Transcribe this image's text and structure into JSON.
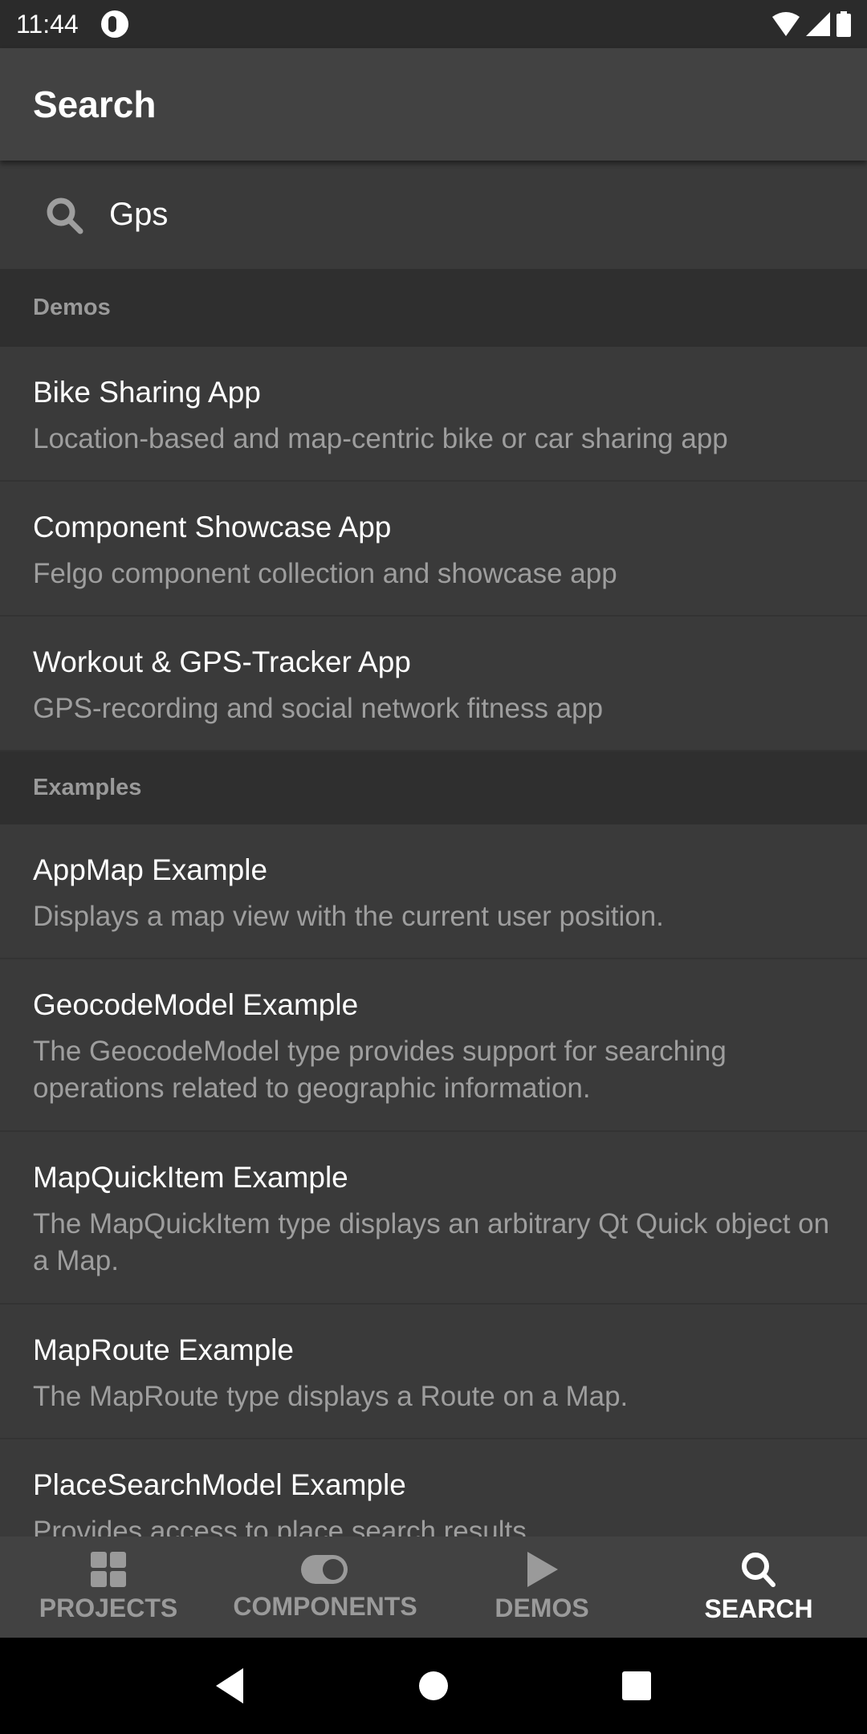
{
  "status_bar": {
    "time": "11:44"
  },
  "app_bar": {
    "title": "Search"
  },
  "search": {
    "value": "Gps"
  },
  "sections": [
    {
      "header": "Demos",
      "items": [
        {
          "title": "Bike Sharing App",
          "subtitle": "Location-based and map-centric bike or car sharing app"
        },
        {
          "title": "Component Showcase App",
          "subtitle": "Felgo component collection and showcase app"
        },
        {
          "title": "Workout & GPS-Tracker App",
          "subtitle": "GPS-recording and social network fitness app"
        }
      ]
    },
    {
      "header": "Examples",
      "items": [
        {
          "title": "AppMap Example",
          "subtitle": "Displays a map view with the current user position."
        },
        {
          "title": "GeocodeModel Example",
          "subtitle": "The GeocodeModel type provides support for searching operations related to geographic information."
        },
        {
          "title": "MapQuickItem Example",
          "subtitle": "The MapQuickItem type displays an arbitrary Qt Quick object on a Map."
        },
        {
          "title": "MapRoute Example",
          "subtitle": "The MapRoute type displays a Route on a Map."
        },
        {
          "title": "PlaceSearchModel Example",
          "subtitle": "Provides access to place search results."
        }
      ]
    }
  ],
  "bottom_nav": {
    "active": "search",
    "tabs": [
      {
        "id": "projects",
        "label": "PROJECTS",
        "icon": "grid-icon"
      },
      {
        "id": "components",
        "label": "COMPONENTS",
        "icon": "toggle-icon"
      },
      {
        "id": "demos",
        "label": "DEMOS",
        "icon": "play-icon"
      },
      {
        "id": "search",
        "label": "SEARCH",
        "icon": "search-icon"
      }
    ]
  },
  "colors": {
    "background": "#3a3a3a",
    "app_bar": "#424242",
    "section_header": "#2f2f2f",
    "active_tab": "#ffffff",
    "inactive_tab": "#9a9a9a"
  }
}
